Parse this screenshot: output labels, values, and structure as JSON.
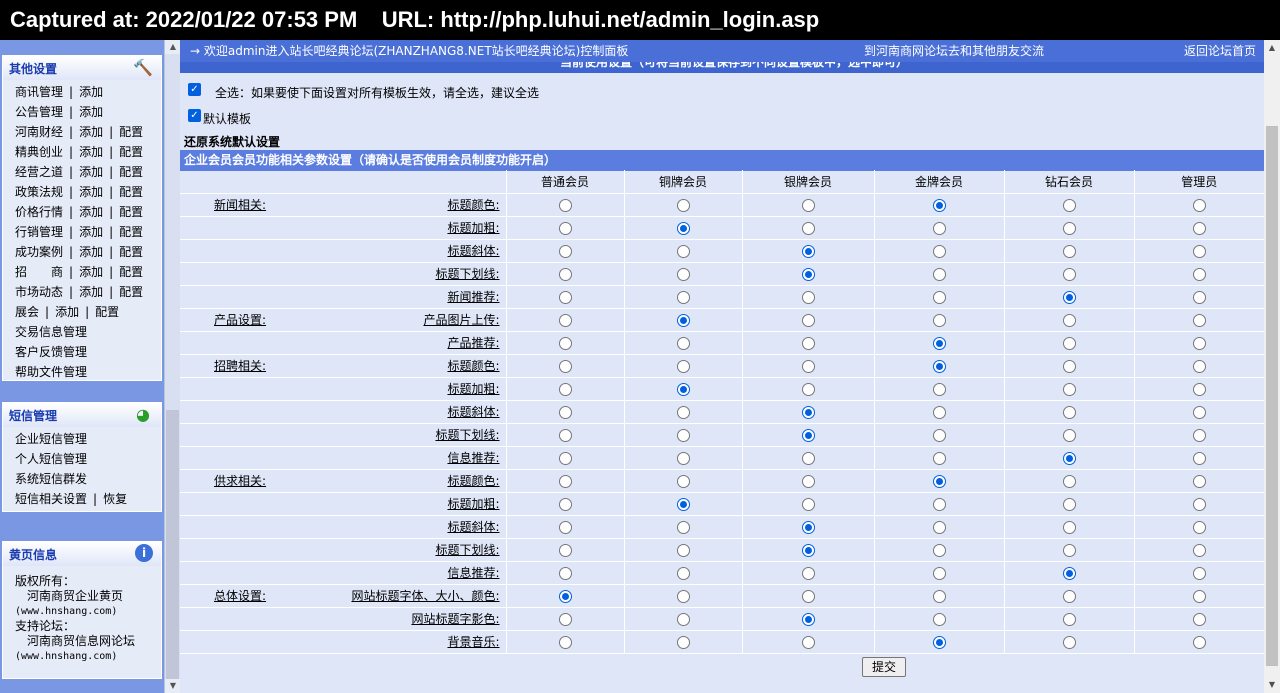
{
  "capture": {
    "text": "Captured at: 2022/01/22 07:53 PM    URL: http://php.luhui.net/admin_login.asp"
  },
  "sidebar": {
    "other_settings": {
      "title": "其他设置",
      "rows": [
        [
          "商讯管理",
          "添加"
        ],
        [
          "公告管理",
          "添加"
        ],
        [
          "河南财经",
          "添加",
          "配置"
        ],
        [
          "精典创业",
          "添加",
          "配置"
        ],
        [
          "经营之道",
          "添加",
          "配置"
        ],
        [
          "政策法规",
          "添加",
          "配置"
        ],
        [
          "价格行情",
          "添加",
          "配置"
        ],
        [
          "行销管理",
          "添加",
          "配置"
        ],
        [
          "成功案例",
          "添加",
          "配置"
        ],
        [
          "招　　商",
          "添加",
          "配置"
        ],
        [
          "市场动态",
          "添加",
          "配置"
        ],
        [
          "展会",
          "添加",
          "配置"
        ],
        [
          "交易信息管理"
        ],
        [
          "客户反馈管理"
        ],
        [
          "帮助文件管理"
        ]
      ]
    },
    "sms": {
      "title": "短信管理",
      "rows": [
        [
          "企业短信管理"
        ],
        [
          "个人短信管理"
        ],
        [
          "系统短信群发"
        ],
        [
          "短信相关设置",
          "恢复"
        ]
      ]
    },
    "yellow": {
      "title": "黄页信息",
      "copyright_label": "版权所有：",
      "copyright_name": "河南商贸企业黄页",
      "copyright_url": "(www.hnshang.com)",
      "support_label": "支持论坛：",
      "support_name": "河南商贸信息网论坛",
      "support_url": "(www.hnshang.com)"
    }
  },
  "topbar": {
    "welcome": "→ 欢迎admin进入站长吧经典论坛(ZHANZHANG8.NET站长吧经典论坛)控制面板",
    "link_other": "到河南商网论坛去和其他朋友交流",
    "link_home": "返回论坛首页"
  },
  "form": {
    "hidden_header": "当前使用设置（可将当前设置保存到不同设置模板中，选中即可）",
    "select_all_label": "全选：如果要使下面设置对所有模板生效，请全选，建议全选",
    "default_template_label": "默认模板",
    "restore_label": "还原系统默认设置",
    "section_title": "企业会员会员功能相关参数设置（请确认是否使用会员制度功能开启）",
    "columns": [
      "普通会员",
      "铜牌会员",
      "银牌会员",
      "金牌会员",
      "钻石会员",
      "管理员"
    ],
    "rows": [
      {
        "group": "新闻相关:",
        "field": "标题颜色:",
        "sel": 3
      },
      {
        "group": "",
        "field": "标题加粗:",
        "sel": 1
      },
      {
        "group": "",
        "field": "标题斜体:",
        "sel": 2
      },
      {
        "group": "",
        "field": "标题下划线:",
        "sel": 2
      },
      {
        "group": "",
        "field": "新闻推荐:",
        "sel": 4
      },
      {
        "group": "产品设置:",
        "field": "产品图片上传:",
        "sel": 1
      },
      {
        "group": "",
        "field": "产品推荐:",
        "sel": 3
      },
      {
        "group": "招聘相关:",
        "field": "标题颜色:",
        "sel": 3
      },
      {
        "group": "",
        "field": "标题加粗:",
        "sel": 1
      },
      {
        "group": "",
        "field": "标题斜体:",
        "sel": 2
      },
      {
        "group": "",
        "field": "标题下划线:",
        "sel": 2
      },
      {
        "group": "",
        "field": "信息推荐:",
        "sel": 4
      },
      {
        "group": "供求相关:",
        "field": "标题颜色:",
        "sel": 3
      },
      {
        "group": "",
        "field": "标题加粗:",
        "sel": 1
      },
      {
        "group": "",
        "field": "标题斜体:",
        "sel": 2
      },
      {
        "group": "",
        "field": "标题下划线:",
        "sel": 2
      },
      {
        "group": "",
        "field": "信息推荐:",
        "sel": 4
      },
      {
        "group": "总体设置:",
        "field": "网站标题字体、大小、颜色:",
        "sel": 0
      },
      {
        "group": "",
        "field": "网站标题字影色:",
        "sel": 2
      },
      {
        "group": "",
        "field": "背景音乐:",
        "sel": 3
      }
    ],
    "submit_label": "提交"
  }
}
